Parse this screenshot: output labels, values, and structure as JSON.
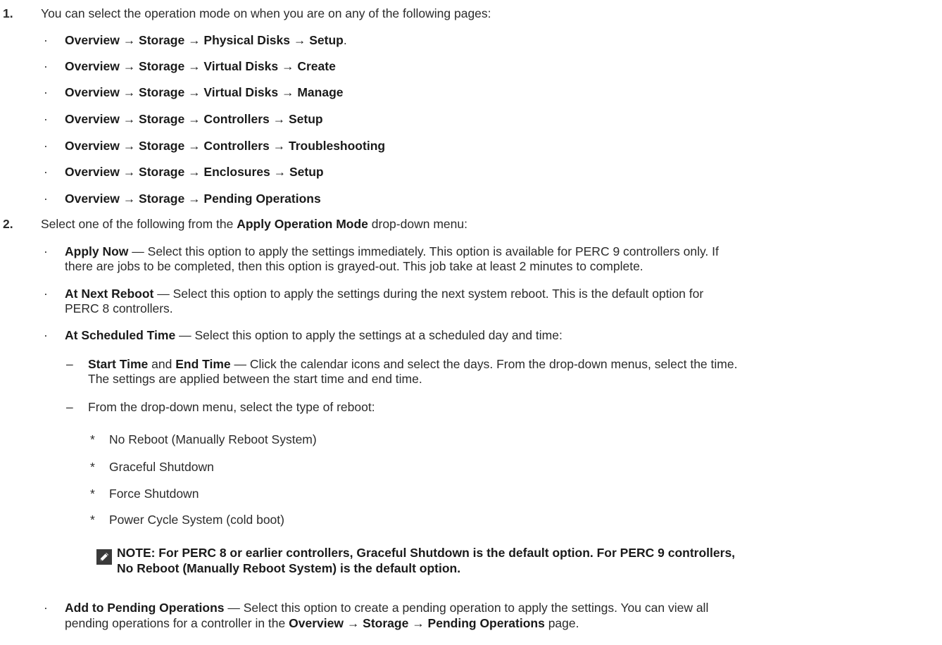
{
  "step1": {
    "num": "1.",
    "intro": "You can select the operation mode on when you are on any of the following pages:",
    "paths": [
      {
        "path": "Overview → Storage → Physical Disks → Setup",
        "suffix": "."
      },
      {
        "path": "Overview → Storage → Virtual Disks → Create",
        "suffix": ""
      },
      {
        "path": "Overview → Storage → Virtual Disks → Manage",
        "suffix": ""
      },
      {
        "path": "Overview → Storage → Controllers → Setup",
        "suffix": ""
      },
      {
        "path": "Overview → Storage → Controllers → Troubleshooting",
        "suffix": ""
      },
      {
        "path": "Overview → Storage → Enclosures → Setup",
        "suffix": ""
      },
      {
        "path": "Overview → Storage → Pending Operations",
        "suffix": ""
      }
    ]
  },
  "step2": {
    "num": "2.",
    "intro_pre": "Select one of the following from the ",
    "intro_bold": "Apply Operation Mode",
    "intro_post": " drop-down menu:",
    "apply_now": {
      "term": "Apply Now",
      "line1": " — Select this option to apply the settings immediately. This option is available for PERC 9 controllers only. If",
      "line2": "there are jobs to be completed, then this option is grayed-out. This job take at least 2 minutes to complete."
    },
    "next_reboot": {
      "term": "At Next Reboot",
      "line1": " — Select this option to apply the settings during the next system reboot. This is the default option for",
      "line2": "PERC 8 controllers."
    },
    "scheduled": {
      "term": "At Scheduled Time",
      "text": " — Select this option to apply the settings at a scheduled day and time:",
      "start_term": "Start Time",
      "and": " and ",
      "end_term": "End Time",
      "start_line1": " — Click the calendar icons and select the days. From the drop-down menus, select the time.",
      "start_line2": "The settings are applied between the start time and end time.",
      "reboot_type": "From the drop-down menu, select the type of reboot:",
      "reboot_options": [
        "No Reboot (Manually Reboot System)",
        "Graceful Shutdown",
        "Force Shutdown",
        "Power Cycle System (cold boot)"
      ],
      "note_line1": "NOTE: For PERC 8 or earlier controllers, Graceful Shutdown is the default option. For PERC 9 controllers,",
      "note_line2": "No Reboot (Manually Reboot System) is the default option."
    },
    "pending": {
      "term": "Add to Pending Operations",
      "line1": " — Select this option to create a pending operation to apply the settings. You can view all",
      "line2_pre": "pending operations for a controller in the ",
      "line2_bold": "Overview → Storage → Pending Operations",
      "line2_post": " page."
    }
  },
  "bullet_glyph": "·",
  "dash_glyph": "–",
  "star_glyph": "*",
  "icon": "note-pencil-icon"
}
